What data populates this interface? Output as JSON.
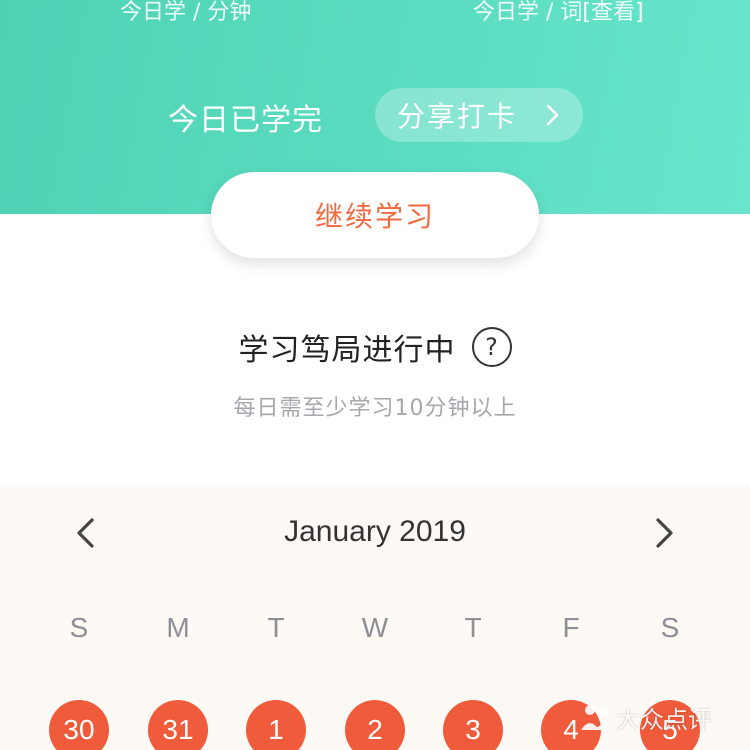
{
  "header": {
    "stat_left_label": "今日学 / 分钟",
    "stat_right_label": "今日学 / 词[查看]",
    "done_text": "今日已学完",
    "share_label": "分享打卡",
    "continue_label": "继续学习"
  },
  "status": {
    "title": "学习笃局进行中",
    "help_symbol": "?",
    "subtitle": "每日需至少学习10分钟以上"
  },
  "calendar": {
    "month_title": "January 2019",
    "weekdays": [
      "S",
      "M",
      "T",
      "W",
      "T",
      "F",
      "S"
    ],
    "days": [
      "30",
      "31",
      "1",
      "2",
      "3",
      "4",
      "5"
    ]
  },
  "watermark": {
    "text": "大众点评"
  },
  "colors": {
    "header_green": "#5bdcc0",
    "accent_orange": "#f2683f",
    "day_circle": "#f05b3c",
    "calendar_bg": "#fdf9f5"
  },
  "icons": {
    "share_chevron": "chevron-right-icon",
    "prev_month": "chevron-left-icon",
    "next_month": "chevron-right-icon",
    "help": "question-circle-icon",
    "watermark_logo": "dianping-logo-icon"
  }
}
